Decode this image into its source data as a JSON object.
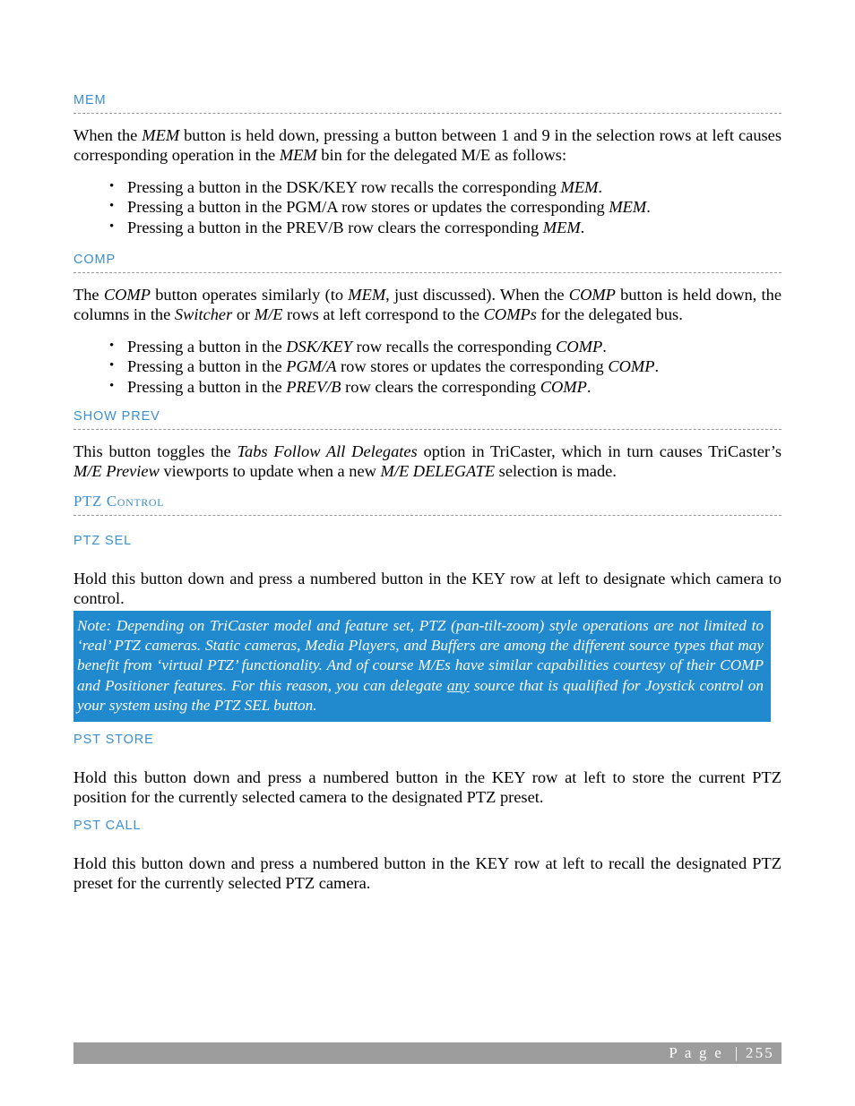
{
  "document": {
    "page_number": "255",
    "footer_label": "P a g e  | 255",
    "accent_heading_color": "#3c8fd0",
    "note_box_color": "#2189ce",
    "footer_bar_color": "#9d9d9d"
  },
  "sections": {
    "mem": {
      "heading": "MEM",
      "paragraph_1": "When the ",
      "paragraph_2": "MEM",
      "paragraph_3": " button is held down, pressing a button between 1 and 9 in the selection rows at left causes corresponding operation in the ",
      "paragraph_4": "MEM",
      "paragraph_5": " bin for the delegated M/E as follows:",
      "bullets": [
        {
          "pre": "Pressing a button in the DSK/KEY row recalls the corresponding ",
          "em": "MEM",
          "post": "."
        },
        {
          "pre": "Pressing a button in the PGM/A row stores or updates the corresponding ",
          "em": "MEM",
          "post": "."
        },
        {
          "pre": "Pressing a button in the PREV/B row clears the corresponding ",
          "em": "MEM",
          "post": "."
        }
      ]
    },
    "comp": {
      "heading": "COMP",
      "p_a": "The ",
      "p_b": "COMP",
      "p_c": " button operates similarly (to ",
      "p_d": "MEM",
      "p_e": ", just discussed). When the ",
      "p_f": "COMP",
      "p_g": " button is held down, the columns in the ",
      "p_h": "Switcher",
      "p_i": " or ",
      "p_j": "M/E",
      "p_k": " rows at left correspond to the ",
      "p_l": "COMPs",
      "p_m": " for the delegated bus.",
      "bullets": [
        {
          "pre": "Pressing a button in the ",
          "em1": "DSK/KEY",
          "mid": " row recalls the corresponding ",
          "em2": "COMP",
          "post": "."
        },
        {
          "pre": "Pressing a button in the ",
          "em1": "PGM/A",
          "mid": " row stores or updates the corresponding ",
          "em2": "COMP",
          "post": "."
        },
        {
          "pre": "Pressing a button in the ",
          "em1": "PREV/B",
          "mid": " row clears the corresponding ",
          "em2": "COMP",
          "post": "."
        }
      ]
    },
    "show_prev": {
      "heading": "SHOW PREV",
      "p_a": "This button toggles the ",
      "p_b": "Tabs Follow All Delegates",
      "p_c": " option in TriCaster, which in turn causes TriCaster’s ",
      "p_d": "M/E Preview",
      "p_e": " viewports to update when a new ",
      "p_f": "M/E DELEGATE",
      "p_g": " selection is made."
    },
    "ptz_control": {
      "heading": "PTZ Control"
    },
    "ptz_sel": {
      "heading": "PTZ SEL",
      "paragraph": "Hold this button down and press a numbered button in the KEY row at left to designate which camera to control."
    },
    "note": {
      "a": "Note: Depending on TriCaster model and feature set, PTZ (pan-tilt-zoom) style operations are not limited to ‘real’ PTZ cameras.  Static cameras, Media Players, and Buffers are among the different source types that may benefit from ‘virtual PTZ’ functionality.  And of course M/Es have similar capabilities courtesy of their COMP and Positioner features.   For this reason, you can delegate ",
      "b": "any",
      "c": " source that is qualified for Joystick control on your system using the PTZ SEL button."
    },
    "pst_store": {
      "heading": "PST STORE",
      "paragraph": "Hold this button down and press a numbered button in the KEY row at left to store the current PTZ position for the currently selected camera to the designated PTZ preset."
    },
    "pst_call": {
      "heading": "PST CALL",
      "paragraph": "Hold this button down and press a numbered button in the KEY row at left to recall the designated PTZ preset for the currently selected PTZ camera."
    }
  }
}
